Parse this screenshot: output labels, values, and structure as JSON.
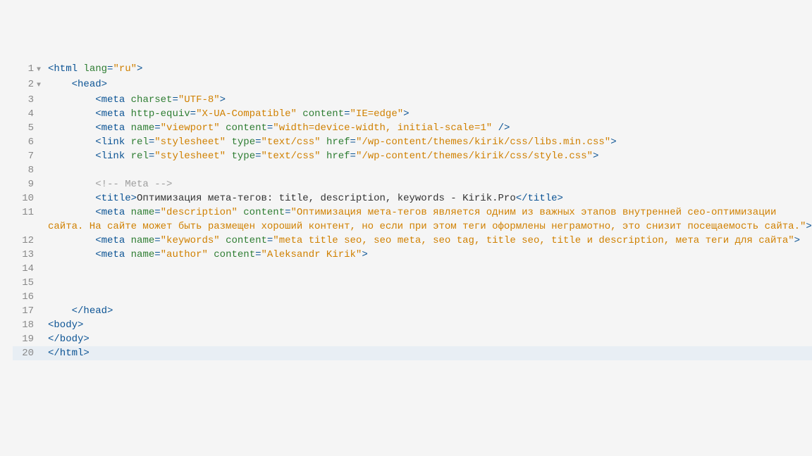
{
  "lines": [
    {
      "num": "1",
      "fold": "▼",
      "indent": 0,
      "tokens": [
        {
          "cls": "tag",
          "t": "<html"
        },
        {
          "cls": "txt",
          "t": " "
        },
        {
          "cls": "attr",
          "t": "lang"
        },
        {
          "cls": "tag",
          "t": "="
        },
        {
          "cls": "str",
          "t": "\"ru\""
        },
        {
          "cls": "tag",
          "t": ">"
        }
      ]
    },
    {
      "num": "2",
      "fold": "▼",
      "indent": 1,
      "tokens": [
        {
          "cls": "tag",
          "t": "<head>"
        }
      ]
    },
    {
      "num": "3",
      "fold": "",
      "indent": 2,
      "tokens": [
        {
          "cls": "tag",
          "t": "<meta"
        },
        {
          "cls": "txt",
          "t": " "
        },
        {
          "cls": "attr",
          "t": "charset"
        },
        {
          "cls": "tag",
          "t": "="
        },
        {
          "cls": "str",
          "t": "\"UTF-8\""
        },
        {
          "cls": "tag",
          "t": ">"
        }
      ]
    },
    {
      "num": "4",
      "fold": "",
      "indent": 2,
      "tokens": [
        {
          "cls": "tag",
          "t": "<meta"
        },
        {
          "cls": "txt",
          "t": " "
        },
        {
          "cls": "attr",
          "t": "http-equiv"
        },
        {
          "cls": "tag",
          "t": "="
        },
        {
          "cls": "str",
          "t": "\"X-UA-Compatible\""
        },
        {
          "cls": "txt",
          "t": " "
        },
        {
          "cls": "attr",
          "t": "content"
        },
        {
          "cls": "tag",
          "t": "="
        },
        {
          "cls": "str",
          "t": "\"IE=edge\""
        },
        {
          "cls": "tag",
          "t": ">"
        }
      ]
    },
    {
      "num": "5",
      "fold": "",
      "indent": 2,
      "tokens": [
        {
          "cls": "tag",
          "t": "<meta"
        },
        {
          "cls": "txt",
          "t": " "
        },
        {
          "cls": "attr",
          "t": "name"
        },
        {
          "cls": "tag",
          "t": "="
        },
        {
          "cls": "str",
          "t": "\"viewport\""
        },
        {
          "cls": "txt",
          "t": " "
        },
        {
          "cls": "attr",
          "t": "content"
        },
        {
          "cls": "tag",
          "t": "="
        },
        {
          "cls": "str",
          "t": "\"width=device-width, initial-scale=1\""
        },
        {
          "cls": "txt",
          "t": " "
        },
        {
          "cls": "tag",
          "t": "/>"
        }
      ]
    },
    {
      "num": "6",
      "fold": "",
      "indent": 2,
      "tokens": [
        {
          "cls": "tag",
          "t": "<link"
        },
        {
          "cls": "txt",
          "t": " "
        },
        {
          "cls": "attr",
          "t": "rel"
        },
        {
          "cls": "tag",
          "t": "="
        },
        {
          "cls": "str",
          "t": "\"stylesheet\""
        },
        {
          "cls": "txt",
          "t": " "
        },
        {
          "cls": "attr",
          "t": "type"
        },
        {
          "cls": "tag",
          "t": "="
        },
        {
          "cls": "str",
          "t": "\"text/css\""
        },
        {
          "cls": "txt",
          "t": " "
        },
        {
          "cls": "attr",
          "t": "href"
        },
        {
          "cls": "tag",
          "t": "="
        },
        {
          "cls": "str",
          "t": "\"/wp-content/themes/kirik/css/libs.min.css\""
        },
        {
          "cls": "tag",
          "t": ">"
        }
      ]
    },
    {
      "num": "7",
      "fold": "",
      "indent": 2,
      "tokens": [
        {
          "cls": "tag",
          "t": "<link"
        },
        {
          "cls": "txt",
          "t": " "
        },
        {
          "cls": "attr",
          "t": "rel"
        },
        {
          "cls": "tag",
          "t": "="
        },
        {
          "cls": "str",
          "t": "\"stylesheet\""
        },
        {
          "cls": "txt",
          "t": " "
        },
        {
          "cls": "attr",
          "t": "type"
        },
        {
          "cls": "tag",
          "t": "="
        },
        {
          "cls": "str",
          "t": "\"text/css\""
        },
        {
          "cls": "txt",
          "t": " "
        },
        {
          "cls": "attr",
          "t": "href"
        },
        {
          "cls": "tag",
          "t": "="
        },
        {
          "cls": "str",
          "t": "\"/wp-content/themes/kirik/css/style.css\""
        },
        {
          "cls": "tag",
          "t": ">"
        }
      ]
    },
    {
      "num": "8",
      "fold": "",
      "indent": 0,
      "tokens": []
    },
    {
      "num": "9",
      "fold": "",
      "indent": 2,
      "tokens": [
        {
          "cls": "cmt",
          "t": "<!-- Meta -->"
        }
      ]
    },
    {
      "num": "10",
      "fold": "",
      "indent": 2,
      "tokens": [
        {
          "cls": "tag",
          "t": "<title>"
        },
        {
          "cls": "txt",
          "t": "Оптимизация мета-тегов: title, description, keywords - Kirik.Pro"
        },
        {
          "cls": "tag",
          "t": "</title>"
        }
      ]
    },
    {
      "num": "11",
      "fold": "",
      "indent": 2,
      "tokens": [
        {
          "cls": "tag",
          "t": "<meta"
        },
        {
          "cls": "txt",
          "t": " "
        },
        {
          "cls": "attr",
          "t": "name"
        },
        {
          "cls": "tag",
          "t": "="
        },
        {
          "cls": "str",
          "t": "\"description\""
        },
        {
          "cls": "txt",
          "t": " "
        },
        {
          "cls": "attr",
          "t": "content"
        },
        {
          "cls": "tag",
          "t": "="
        },
        {
          "cls": "str",
          "t": "\"Оптимизация мета-тегов является одним из важных этапов внутренней сео-оптимизации сайта. На сайте может быть размещен хороший контент, но если при этом теги оформлены неграмотно, это снизит посещаемость сайта.\""
        },
        {
          "cls": "tag",
          "t": ">"
        }
      ]
    },
    {
      "num": "12",
      "fold": "",
      "indent": 2,
      "tokens": [
        {
          "cls": "tag",
          "t": "<meta"
        },
        {
          "cls": "txt",
          "t": " "
        },
        {
          "cls": "attr",
          "t": "name"
        },
        {
          "cls": "tag",
          "t": "="
        },
        {
          "cls": "str",
          "t": "\"keywords\""
        },
        {
          "cls": "txt",
          "t": " "
        },
        {
          "cls": "attr",
          "t": "content"
        },
        {
          "cls": "tag",
          "t": "="
        },
        {
          "cls": "str",
          "t": "\"meta title seo, seo meta, seo tag, title seo, title и description, мета теги для сайта\""
        },
        {
          "cls": "tag",
          "t": ">"
        }
      ]
    },
    {
      "num": "13",
      "fold": "",
      "indent": 2,
      "tokens": [
        {
          "cls": "tag",
          "t": "<meta"
        },
        {
          "cls": "txt",
          "t": " "
        },
        {
          "cls": "attr",
          "t": "name"
        },
        {
          "cls": "tag",
          "t": "="
        },
        {
          "cls": "str",
          "t": "\"author\""
        },
        {
          "cls": "txt",
          "t": " "
        },
        {
          "cls": "attr",
          "t": "content"
        },
        {
          "cls": "tag",
          "t": "="
        },
        {
          "cls": "str",
          "t": "\"Aleksandr Kirik\""
        },
        {
          "cls": "tag",
          "t": ">"
        }
      ]
    },
    {
      "num": "14",
      "fold": "",
      "indent": 0,
      "tokens": []
    },
    {
      "num": "15",
      "fold": "",
      "indent": 0,
      "tokens": []
    },
    {
      "num": "16",
      "fold": "",
      "indent": 0,
      "tokens": []
    },
    {
      "num": "17",
      "fold": "",
      "indent": 1,
      "tokens": [
        {
          "cls": "tag",
          "t": "</head>"
        }
      ]
    },
    {
      "num": "18",
      "fold": "",
      "indent": 0,
      "tokens": [
        {
          "cls": "tag",
          "t": "<body>"
        }
      ]
    },
    {
      "num": "19",
      "fold": "",
      "indent": 0,
      "tokens": [
        {
          "cls": "tag",
          "t": "</body>"
        }
      ]
    },
    {
      "num": "20",
      "fold": "",
      "indent": 0,
      "hl": true,
      "tokens": [
        {
          "cls": "tag",
          "t": "</html>"
        }
      ]
    }
  ],
  "indent_unit": "    "
}
